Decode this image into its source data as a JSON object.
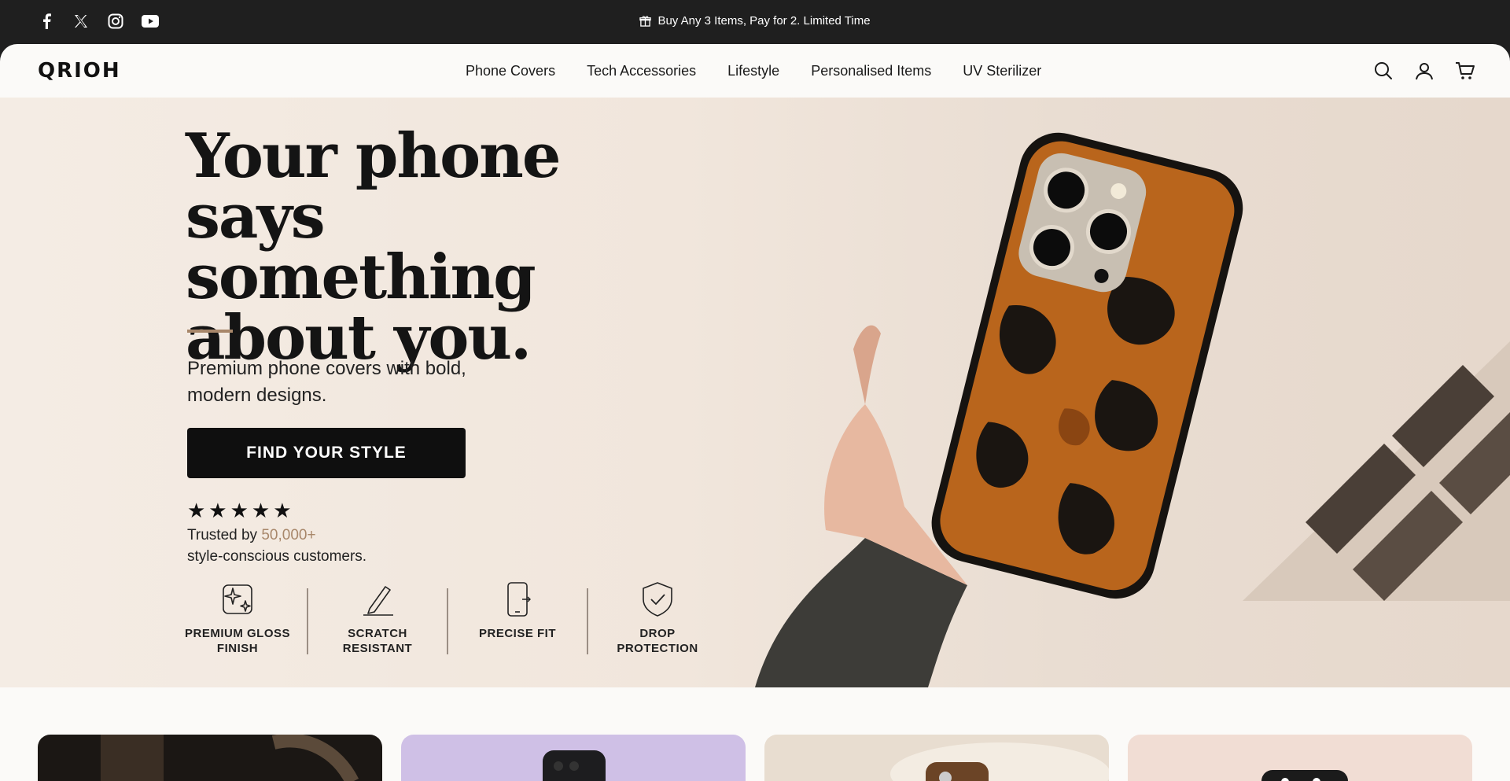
{
  "announcement": {
    "text": "Buy Any 3 Items, Pay for 2. Limited Time",
    "icon": "gift-icon"
  },
  "socials": [
    {
      "name": "facebook-icon"
    },
    {
      "name": "x-twitter-icon"
    },
    {
      "name": "instagram-icon"
    },
    {
      "name": "youtube-icon"
    }
  ],
  "header": {
    "logo": "QRIOH",
    "nav": [
      "Phone Covers",
      "Tech Accessories",
      "Lifestyle",
      "Personalised Items",
      "UV Sterilizer"
    ],
    "icons": [
      "search-icon",
      "account-icon",
      "cart-icon"
    ]
  },
  "hero": {
    "title": "Your phone says something about you.",
    "subtitle": "Premium phone covers with bold, modern designs.",
    "cta": "FIND YOUR STYLE",
    "stars": "★★★★★",
    "rating": 5,
    "trust_prefix": "Trusted by",
    "trust_highlight": "50,000+",
    "trust_suffix": "style-conscious customers.",
    "accent_color": "#a8876a",
    "features": [
      {
        "icon": "sparkle-icon",
        "label": "PREMIUM GLOSS FINISH"
      },
      {
        "icon": "pen-icon",
        "label": "SCRATCH RESISTANT"
      },
      {
        "icon": "phone-fit-icon",
        "label": "PRECISE FIT"
      },
      {
        "icon": "shield-check-icon",
        "label": "DROP PROTECTION"
      }
    ]
  },
  "product_cards": [
    {
      "name": "product-card-1",
      "color": "#1b1714"
    },
    {
      "name": "product-card-2",
      "color": "#cfc0e6"
    },
    {
      "name": "product-card-3",
      "color": "#e8ddd0"
    },
    {
      "name": "product-card-4",
      "color": "#f1ddd4"
    }
  ]
}
